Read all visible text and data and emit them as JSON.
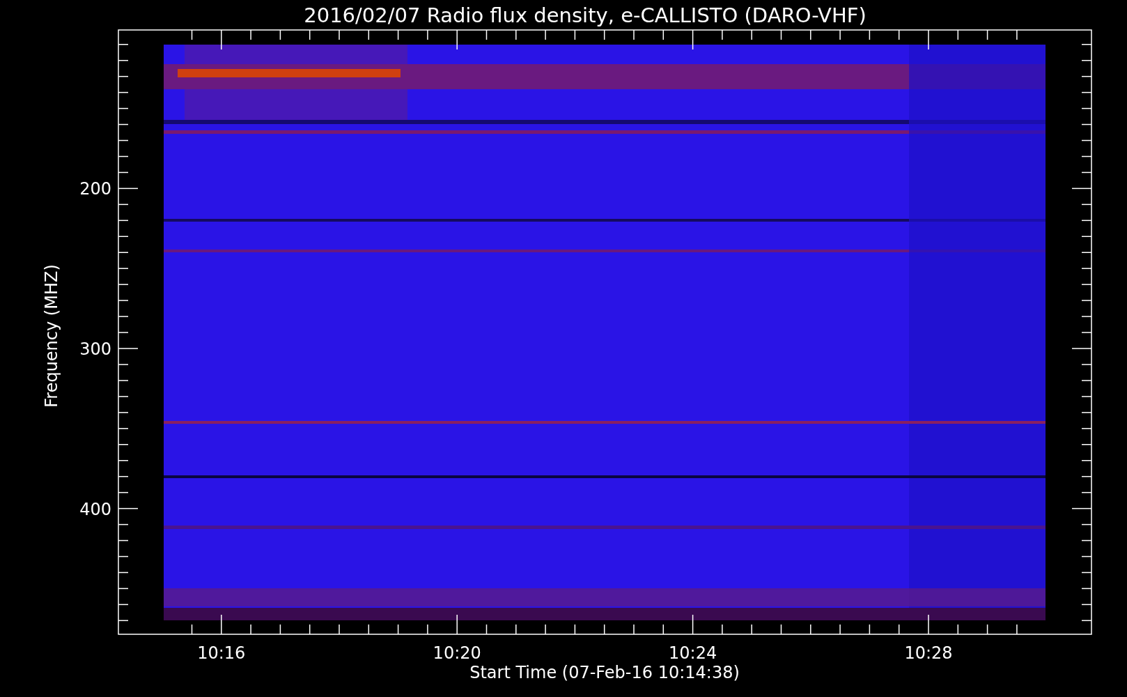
{
  "title": "2016/02/07  Radio flux density, e-CALLISTO (DARO-VHF)",
  "y_axis": {
    "label": "Frequency (MHZ)",
    "tick_labels": [
      "200",
      "300",
      "400"
    ]
  },
  "x_axis": {
    "label": "Start Time (07-Feb-16 10:14:38)",
    "tick_labels": [
      "10:16",
      "10:20",
      "10:24",
      "10:28"
    ]
  }
}
